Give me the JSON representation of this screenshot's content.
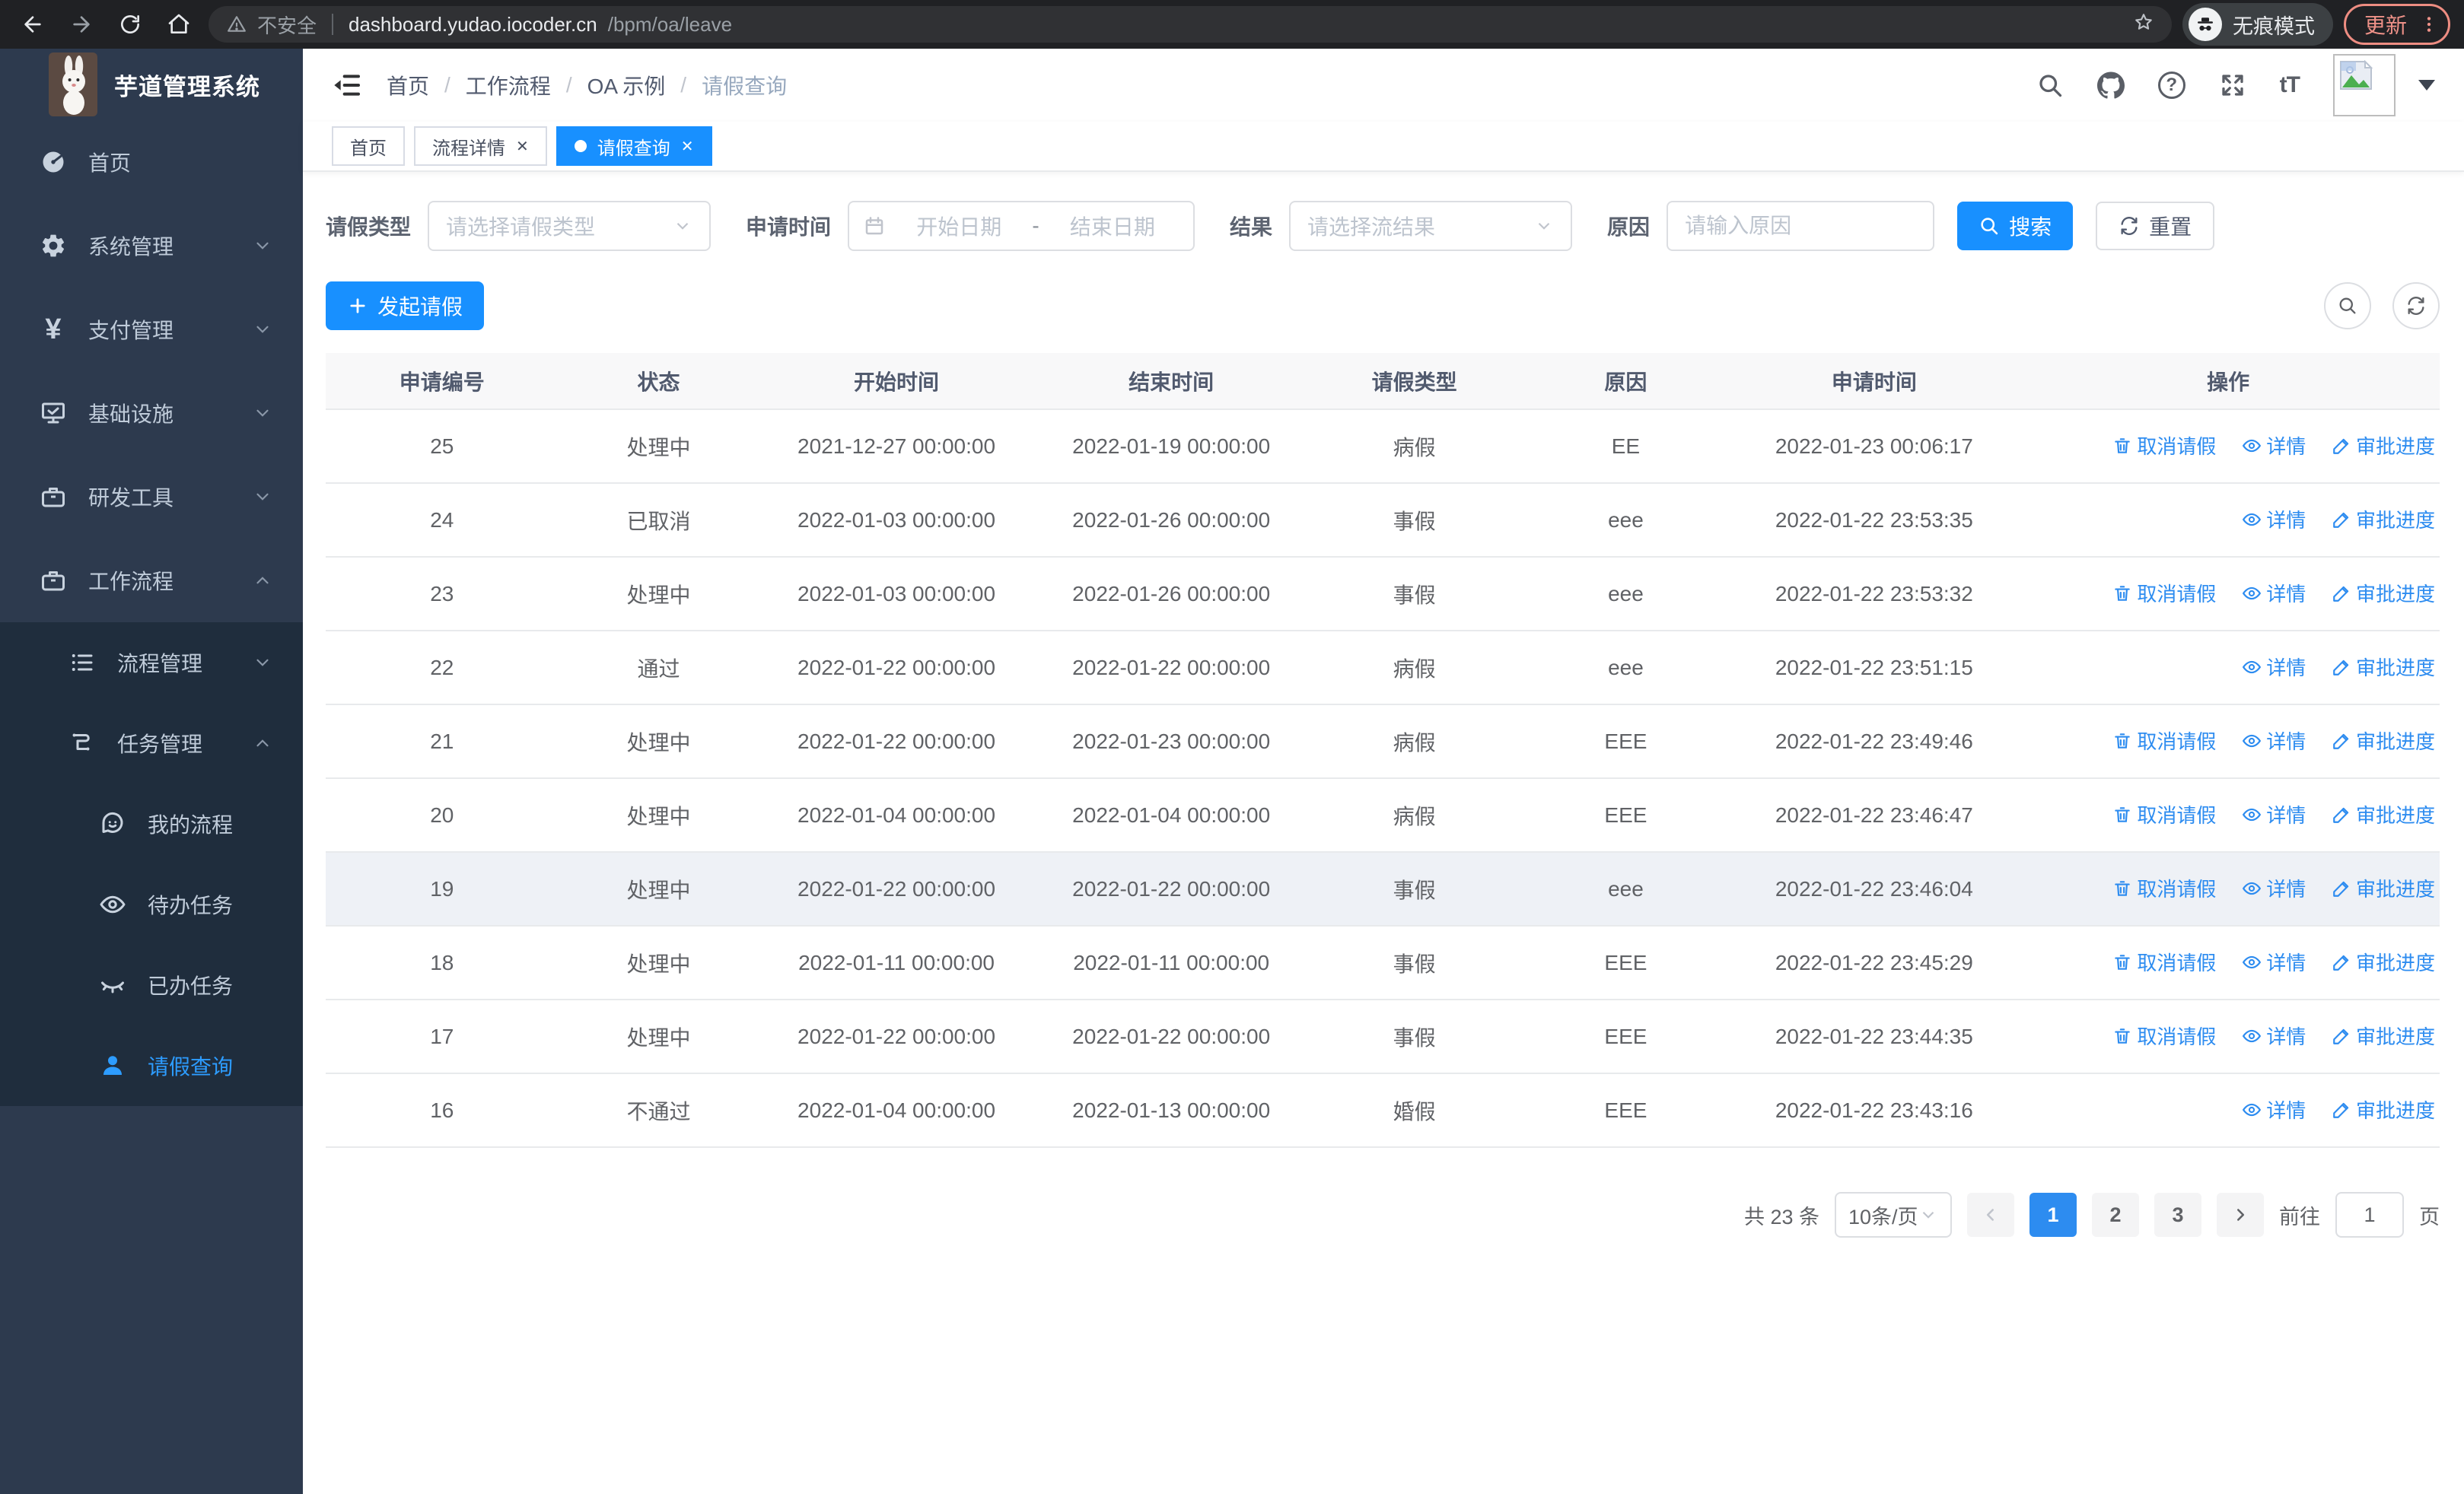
{
  "colors": {
    "accent": "#1890ff",
    "sidebar_bg": "#2d3a4e",
    "submenu_bg": "#1f2d3d",
    "link_blue": "#2d8cf0"
  },
  "browser": {
    "security_label": "不安全",
    "url_host": "dashboard.yudao.iocoder.cn",
    "url_path": "/bpm/oa/leave",
    "incognito_label": "无痕模式",
    "update_label": "更新"
  },
  "sidebar": {
    "title": "芋道管理系统",
    "items": [
      {
        "label": "首页"
      },
      {
        "label": "系统管理"
      },
      {
        "label": "支付管理"
      },
      {
        "label": "基础设施"
      },
      {
        "label": "研发工具"
      },
      {
        "label": "工作流程"
      }
    ],
    "submenu": [
      {
        "label": "流程管理"
      },
      {
        "label": "任务管理"
      }
    ],
    "task_children": [
      {
        "label": "我的流程"
      },
      {
        "label": "待办任务"
      },
      {
        "label": "已办任务"
      },
      {
        "label": "请假查询"
      }
    ]
  },
  "header": {
    "breadcrumb": [
      "首页",
      "工作流程",
      "OA 示例",
      "请假查询"
    ]
  },
  "tabs": [
    {
      "label": "首页"
    },
    {
      "label": "流程详情"
    },
    {
      "label": "请假查询"
    }
  ],
  "filters": {
    "leave_type_label": "请假类型",
    "leave_type_placeholder": "请选择请假类型",
    "apply_time_label": "申请时间",
    "start_date_placeholder": "开始日期",
    "date_separator": "-",
    "end_date_placeholder": "结束日期",
    "result_label": "结果",
    "result_placeholder": "请选择流结果",
    "reason_label": "原因",
    "reason_placeholder": "请输入原因",
    "search_button": "搜索",
    "reset_button": "重置"
  },
  "toolbar": {
    "create_button": "发起请假"
  },
  "table": {
    "columns": [
      "申请编号",
      "状态",
      "开始时间",
      "结束时间",
      "请假类型",
      "原因",
      "申请时间",
      "操作"
    ],
    "actions": {
      "cancel": "取消请假",
      "detail": "详情",
      "progress": "审批进度"
    },
    "rows": [
      {
        "id": "25",
        "status": "处理中",
        "start": "2021-12-27 00:00:00",
        "end": "2022-01-19 00:00:00",
        "type": "病假",
        "reason": "EE",
        "apply_time": "2022-01-23 00:06:17"
      },
      {
        "id": "24",
        "status": "已取消",
        "start": "2022-01-03 00:00:00",
        "end": "2022-01-26 00:00:00",
        "type": "事假",
        "reason": "eee",
        "apply_time": "2022-01-22 23:53:35"
      },
      {
        "id": "23",
        "status": "处理中",
        "start": "2022-01-03 00:00:00",
        "end": "2022-01-26 00:00:00",
        "type": "事假",
        "reason": "eee",
        "apply_time": "2022-01-22 23:53:32"
      },
      {
        "id": "22",
        "status": "通过",
        "start": "2022-01-22 00:00:00",
        "end": "2022-01-22 00:00:00",
        "type": "病假",
        "reason": "eee",
        "apply_time": "2022-01-22 23:51:15"
      },
      {
        "id": "21",
        "status": "处理中",
        "start": "2022-01-22 00:00:00",
        "end": "2022-01-23 00:00:00",
        "type": "病假",
        "reason": "EEE",
        "apply_time": "2022-01-22 23:49:46"
      },
      {
        "id": "20",
        "status": "处理中",
        "start": "2022-01-04 00:00:00",
        "end": "2022-01-04 00:00:00",
        "type": "病假",
        "reason": "EEE",
        "apply_time": "2022-01-22 23:46:47"
      },
      {
        "id": "19",
        "status": "处理中",
        "start": "2022-01-22 00:00:00",
        "end": "2022-01-22 00:00:00",
        "type": "事假",
        "reason": "eee",
        "apply_time": "2022-01-22 23:46:04"
      },
      {
        "id": "18",
        "status": "处理中",
        "start": "2022-01-11 00:00:00",
        "end": "2022-01-11 00:00:00",
        "type": "事假",
        "reason": "EEE",
        "apply_time": "2022-01-22 23:45:29"
      },
      {
        "id": "17",
        "status": "处理中",
        "start": "2022-01-22 00:00:00",
        "end": "2022-01-22 00:00:00",
        "type": "事假",
        "reason": "EEE",
        "apply_time": "2022-01-22 23:44:35"
      },
      {
        "id": "16",
        "status": "不通过",
        "start": "2022-01-04 00:00:00",
        "end": "2022-01-13 00:00:00",
        "type": "婚假",
        "reason": "EEE",
        "apply_time": "2022-01-22 23:43:16"
      }
    ]
  },
  "pagination": {
    "total": "共 23 条",
    "page_size": "10条/页",
    "pages": [
      "1",
      "2",
      "3"
    ],
    "active_page": "1",
    "goto_label": "前往",
    "goto_value": "1",
    "goto_unit": "页"
  }
}
